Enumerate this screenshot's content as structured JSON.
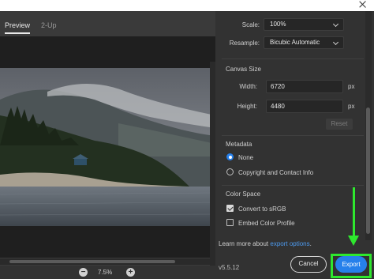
{
  "tabs": [
    {
      "label": "Preview"
    },
    {
      "label": "2-Up"
    }
  ],
  "zoom": {
    "level": "7.5%",
    "minus": "−",
    "plus": "+"
  },
  "image_size": {
    "scale_label": "Scale:",
    "scale_value": "100%",
    "resample_label": "Resample:",
    "resample_value": "Bicubic Automatic"
  },
  "canvas_size": {
    "title": "Canvas Size",
    "width_label": "Width:",
    "width_value": "6720",
    "height_label": "Height:",
    "height_value": "4480",
    "unit": "px",
    "reset_label": "Reset"
  },
  "metadata": {
    "title": "Metadata",
    "options": [
      {
        "label": "None",
        "selected": true
      },
      {
        "label": "Copyright and Contact Info",
        "selected": false
      }
    ]
  },
  "color_space": {
    "title": "Color Space",
    "options": [
      {
        "label": "Convert to sRGB",
        "checked": true
      },
      {
        "label": "Embed Color Profile",
        "checked": false
      }
    ]
  },
  "learn_more": {
    "prefix": "Learn more about ",
    "link": "export options",
    "suffix": "."
  },
  "footer": {
    "version": "v5.5.12",
    "cancel_label": "Cancel",
    "export_label": "Export"
  },
  "colors": {
    "accent": "#2680eb",
    "highlight": "#2ee82e",
    "panel": "#323232"
  },
  "icons": [
    "close-icon",
    "chevron-down-icon",
    "zoom-out-icon",
    "zoom-in-icon",
    "arrow-down-icon"
  ]
}
